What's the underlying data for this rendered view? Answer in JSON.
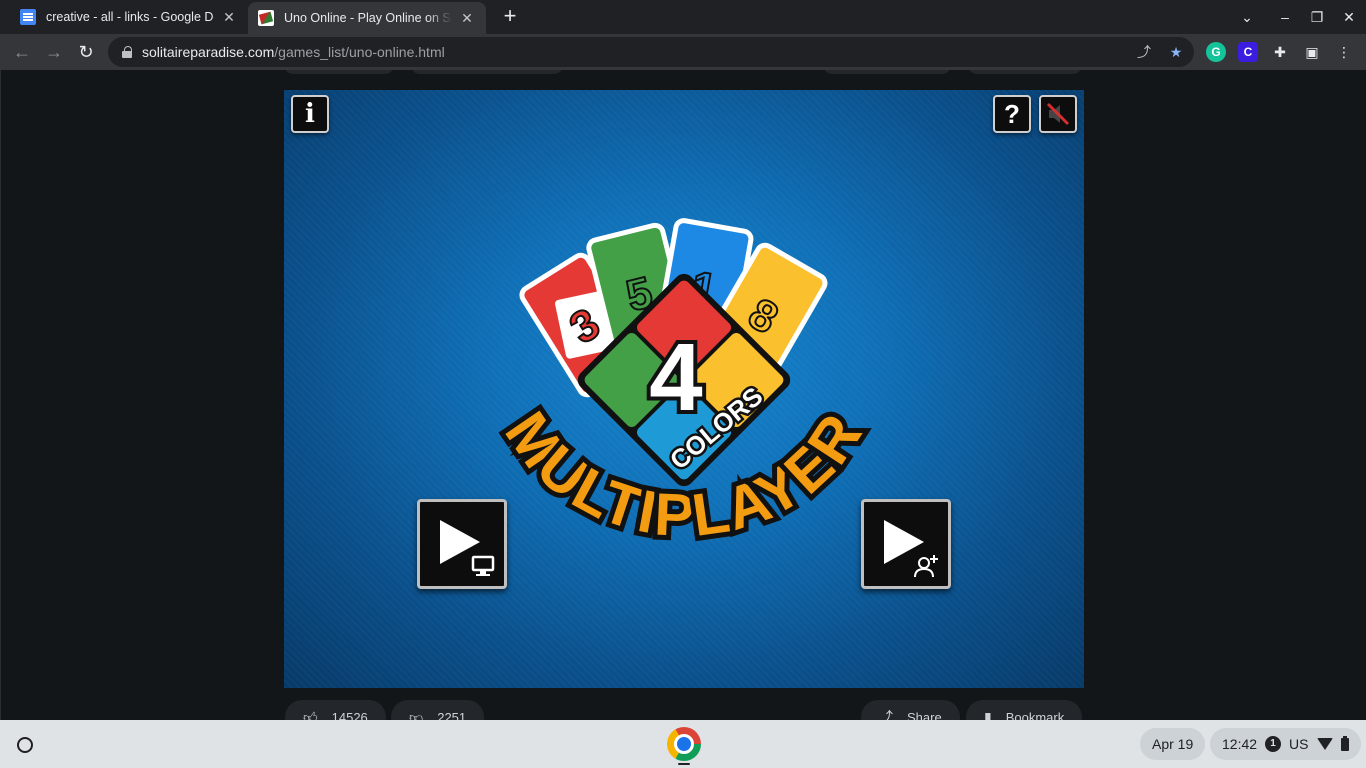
{
  "tabs": [
    {
      "title": "creative - all - links - Google Docs",
      "active": false,
      "icon": "google-docs-icon"
    },
    {
      "title": "Uno Online - Play Online on SolitaireParadise.com",
      "active": true,
      "icon": "solitaire-paradise-icon"
    }
  ],
  "omnibox": {
    "domain": "solitaireparadise.com",
    "path": "/games_list/uno-online.html"
  },
  "game": {
    "logo": {
      "number": "4",
      "colors_word": "COLORS",
      "title_word": "MULTIPLAYER",
      "cards": [
        {
          "value": "3",
          "color": "#e53935"
        },
        {
          "value": "5",
          "color": "#43a047"
        },
        {
          "value": "1",
          "color": "#1e88e5"
        },
        {
          "value": "8",
          "color": "#fbc02d"
        }
      ]
    },
    "buttons": {
      "info": "i",
      "help": "?"
    }
  },
  "actions": {
    "likes": "14526",
    "dislikes": "2251",
    "share": "Share",
    "bookmark": "Bookmark"
  },
  "shelf": {
    "date": "Apr 19",
    "time": "12:42",
    "notifications": "1",
    "keyboard": "US"
  },
  "colors": {
    "accent_orange": "#f39c12",
    "game_blue": "#0f6fb6",
    "browser_dark": "#35363a"
  }
}
